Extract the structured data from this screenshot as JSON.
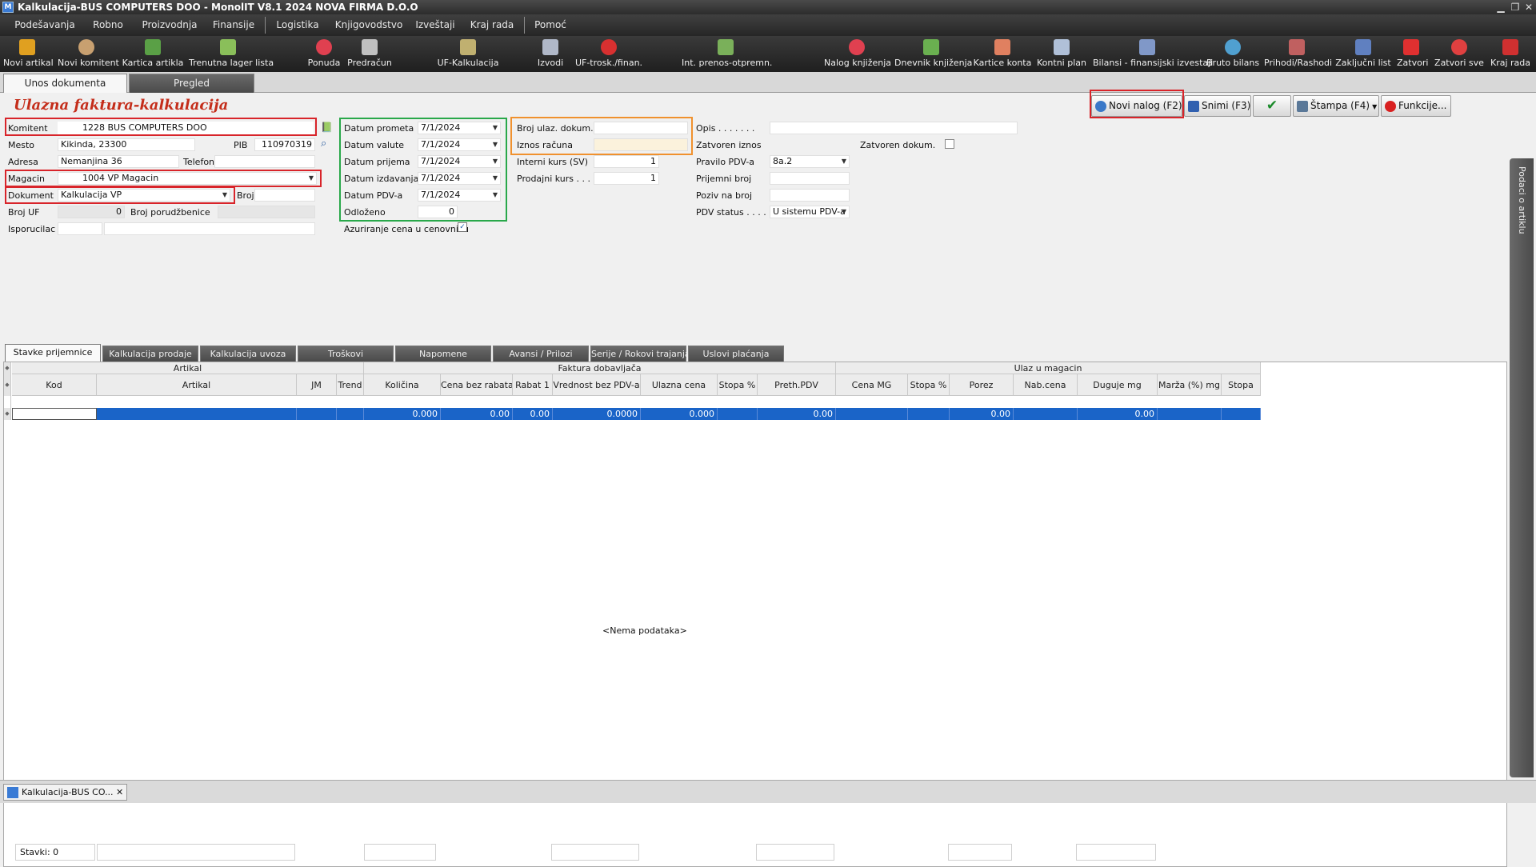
{
  "window": {
    "title": "Kalkulacija-BUS COMPUTERS DOO - MonolIT V8.1 2024 NOVA FIRMA D.O.O",
    "app_icon": "M",
    "minimize": "▁",
    "restore": "❐",
    "close": "✕"
  },
  "menu": [
    "Podešavanja",
    "Robno",
    "Proizvodnja",
    "Finansije",
    "Logistika",
    "Knjigovodstvo",
    "Izveštaji",
    "Kraj rada",
    "Pomoć"
  ],
  "toolbar": [
    {
      "label": "Novi artikal",
      "icon": "box-icon",
      "color": "#e0a020"
    },
    {
      "label": "Novi komitent",
      "icon": "person-add-icon",
      "color": "#c8a070"
    },
    {
      "label": "Kartica artikla",
      "icon": "card-icon",
      "color": "#5aa046"
    },
    {
      "label": "Trenutna lager lista",
      "icon": "list-icon",
      "color": "#8abf5a"
    },
    {
      "label": "Ponuda",
      "icon": "offer-icon",
      "color": "#e04050"
    },
    {
      "label": "Predračun",
      "icon": "document-icon",
      "color": "#c0c0c0"
    },
    {
      "label": "UF-Kalkulacija",
      "icon": "calc-icon",
      "color": "#c0b070"
    },
    {
      "label": "Izvodi",
      "icon": "statement-icon",
      "color": "#b0b8c8"
    },
    {
      "label": "UF-trosk./finan.",
      "icon": "invoice-icon",
      "color": "#d83030"
    },
    {
      "label": "Int. prenos-otpremn.",
      "icon": "transfer-icon",
      "color": "#7ab05a"
    },
    {
      "label": "Nalog knjiženja",
      "icon": "book-icon",
      "color": "#e04050"
    },
    {
      "label": "Dnevnik knjiženja",
      "icon": "journal-icon",
      "color": "#6ab050"
    },
    {
      "label": "Kartice konta",
      "icon": "account-card-icon",
      "color": "#e08060"
    },
    {
      "label": "Kontni plan",
      "icon": "chart-of-accounts-icon",
      "color": "#b0c0d8"
    },
    {
      "label": "Bilansi - finansijski izvestaji",
      "icon": "balance-icon",
      "color": "#8098c8"
    },
    {
      "label": "Bruto bilans",
      "icon": "pie-icon",
      "color": "#50a0d0"
    },
    {
      "label": "Prihodi/Rashodi",
      "icon": "income-icon",
      "color": "#c06060"
    },
    {
      "label": "Zaključni list",
      "icon": "final-sheet-icon",
      "color": "#6080c0"
    },
    {
      "label": "Zatvori",
      "icon": "close-icon",
      "color": "#e03030"
    },
    {
      "label": "Zatvori sve",
      "icon": "close-all-icon",
      "color": "#e04040"
    },
    {
      "label": "Kraj rada",
      "icon": "exit-icon",
      "color": "#d03030"
    }
  ],
  "tabs": {
    "entry": "Unos dokumenta",
    "review": "Pregled"
  },
  "form": {
    "heading": "Ulazna faktura-kalkulacija",
    "komitent_label": "Komitent",
    "komitent_value": "1228 BUS COMPUTERS DOO",
    "mesto_label": "Mesto",
    "mesto_value": "Kikinda, 23300",
    "pib_label": "PIB",
    "pib_value": "110970319",
    "adresa_label": "Adresa",
    "adresa_value": "Nemanjina 36",
    "telefon_label": "Telefon",
    "telefon_value": "",
    "magacin_label": "Magacin",
    "magacin_value": "1004 VP Magacin",
    "dokument_label": "Dokument",
    "dokument_value": "Kalkulacija VP",
    "broj_label": "Broj",
    "broj_value": "",
    "broj_uf_label": "Broj UF",
    "broj_uf_value": "0",
    "broj_porudzbenice_label": "Broj porudžbenice",
    "broj_porudzbenice_value": "",
    "isporucilac_label": "Isporucilac",
    "isporucilac_value": "",
    "datum_prometa_label": "Datum prometa",
    "datum_prometa": "7/1/2024",
    "datum_valute_label": "Datum valute",
    "datum_valute": "7/1/2024",
    "datum_prijema_label": "Datum prijema",
    "datum_prijema": "7/1/2024",
    "datum_izdavanja_label": "Datum izdavanja",
    "datum_izdavanja": "7/1/2024",
    "datum_pdv_label": "Datum PDV-a",
    "datum_pdv": "7/1/2024",
    "odlozeno_label": "Odloženo",
    "odlozeno": "0",
    "azuriranje_label": "Azuriranje cena u cenovniku",
    "azuriranje_checked": true,
    "broj_ulaz_label": "Broj ulaz. dokum.",
    "broj_ulaz": "",
    "iznos_racuna_label": "Iznos računa",
    "iznos_racuna": "",
    "interni_kurs_label": "Interni kurs (SV)",
    "interni_kurs": "1",
    "prodajni_kurs_label": "Prodajni kurs . . .",
    "prodajni_kurs": "1",
    "opis_label": "Opis . . . . . . .",
    "opis": "",
    "zatvoren_iznos_label": "Zatvoren iznos",
    "zatvoren_dokum_label": "Zatvoren dokum.",
    "zatvoren_dokum_checked": false,
    "pravilo_pdv_label": "Pravilo PDV-a",
    "pravilo_pdv": "8a.2",
    "prijemni_broj_label": "Prijemni broj",
    "prijemni_broj": "",
    "poziv_label": "Poziv na broj",
    "poziv": "",
    "pdv_status_label": "PDV status . . . .",
    "pdv_status": "U sistemu PDV-a"
  },
  "actions": {
    "new": "Novi nalog (F2)",
    "save": "Snimi (F3)",
    "print": "Štampa (F4)",
    "functions": "Funkcije..."
  },
  "subtabs": [
    "Stavke prijemnice",
    "Kalkulacija prodaje",
    "Kalkulacija uvoza",
    "Troškovi",
    "Napomene",
    "Avansi / Prilozi",
    "Serije / Rokovi trajanja",
    "Uslovi plaćanja"
  ],
  "grid": {
    "groups": {
      "artikal": "Artikal",
      "faktura": "Faktura dobavljača",
      "ulaz": "Ulaz u magacin"
    },
    "columns": [
      "Kod",
      "Artikal",
      "JM",
      "Trend",
      "Količina",
      "Cena bez rabata",
      "Rabat 1",
      "Vrednost bez PDV-a",
      "Ulazna cena",
      "Stopa %",
      "Preth.PDV",
      "Cena MG",
      "Stopa %",
      "Porez",
      "Nab.cena",
      "Duguje mg",
      "Marža (%) mg",
      "Stopa"
    ],
    "row": [
      "",
      "",
      "",
      "",
      "0.000",
      "0.00",
      "0.00",
      "0.0000",
      "0.000",
      "",
      "0.00",
      "",
      "",
      "0.00",
      "",
      "0.00",
      "",
      ""
    ],
    "empty_text": "<Nema podataka>",
    "footer_count": "Stavki: 0"
  },
  "side_panel": "Podaci o artiklu",
  "taskbar": {
    "item": "Kalkulacija-BUS CO...",
    "close": "✕"
  }
}
